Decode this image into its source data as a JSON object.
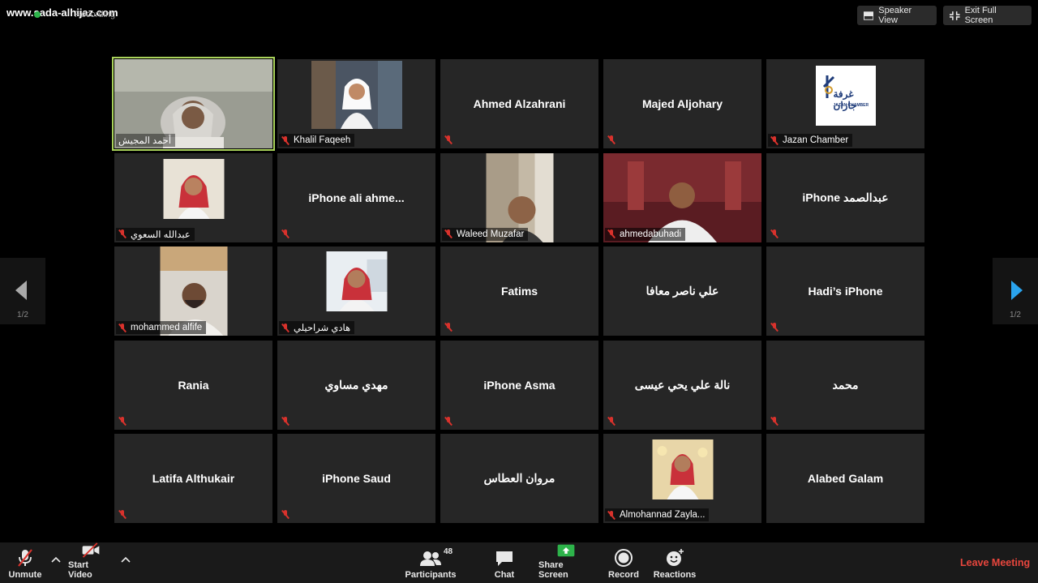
{
  "watermark": "www.sada-alhijaz.com",
  "recording_label": "Recording",
  "top_buttons": {
    "speaker_view": "Speaker View",
    "exit_full_screen": "Exit Full Screen"
  },
  "tiles": [
    {
      "name": "أحمد المجيش",
      "video": true
    },
    {
      "name": "Khalil Faqeeh",
      "video": true
    },
    {
      "name": "Ahmed Alzahrani",
      "video": false
    },
    {
      "name": "Majed Aljohary",
      "video": false
    },
    {
      "name": "Jazan Chamber",
      "video": true
    },
    {
      "name": "عبدالله السعوي",
      "video": true
    },
    {
      "name": "iPhone ali ahme...",
      "video": false
    },
    {
      "name": "Waleed Muzafar",
      "video": true
    },
    {
      "name": "ahmedabuhadi",
      "video": true
    },
    {
      "name": "iPhone عبدالصمد",
      "video": false
    },
    {
      "name": "mohammed alfife",
      "video": true
    },
    {
      "name": "هادي شراحيلي",
      "video": true
    },
    {
      "name": "Fatims",
      "video": false
    },
    {
      "name": "علي ناصر معافا",
      "video": false
    },
    {
      "name": "Hadi’s iPhone",
      "video": false
    },
    {
      "name": "Rania",
      "video": false
    },
    {
      "name": "مهدي مساوي",
      "video": false
    },
    {
      "name": "iPhone Asma",
      "video": false
    },
    {
      "name": "نالة علي يحي عيسى",
      "video": false
    },
    {
      "name": "محمد",
      "video": false
    },
    {
      "name": "Latifa Althukair",
      "video": false
    },
    {
      "name": "iPhone Saud",
      "video": false
    },
    {
      "name": "مروان العطاس",
      "video": false
    },
    {
      "name": "Almohannad Zayla...",
      "video": true
    },
    {
      "name": "Alabed Galam",
      "video": false
    }
  ],
  "jazan_logo": {
    "arabic": "غرفة جازان",
    "english": "JAZAN CHAMBER"
  },
  "pager": {
    "left": "1/2",
    "right": "1/2"
  },
  "toolbar": {
    "unmute": "Unmute",
    "start_video": "Start Video",
    "participants": "Participants",
    "participants_count": "48",
    "chat": "Chat",
    "share_screen": "Share Screen",
    "record": "Record",
    "reactions": "Reactions",
    "leave": "Leave Meeting"
  },
  "colors": {
    "active_border": "#a9d25a",
    "mute_red": "#d9322c",
    "share_green": "#2db34a",
    "leave_red": "#e8463d",
    "next_arrow": "#2aa4ee"
  }
}
